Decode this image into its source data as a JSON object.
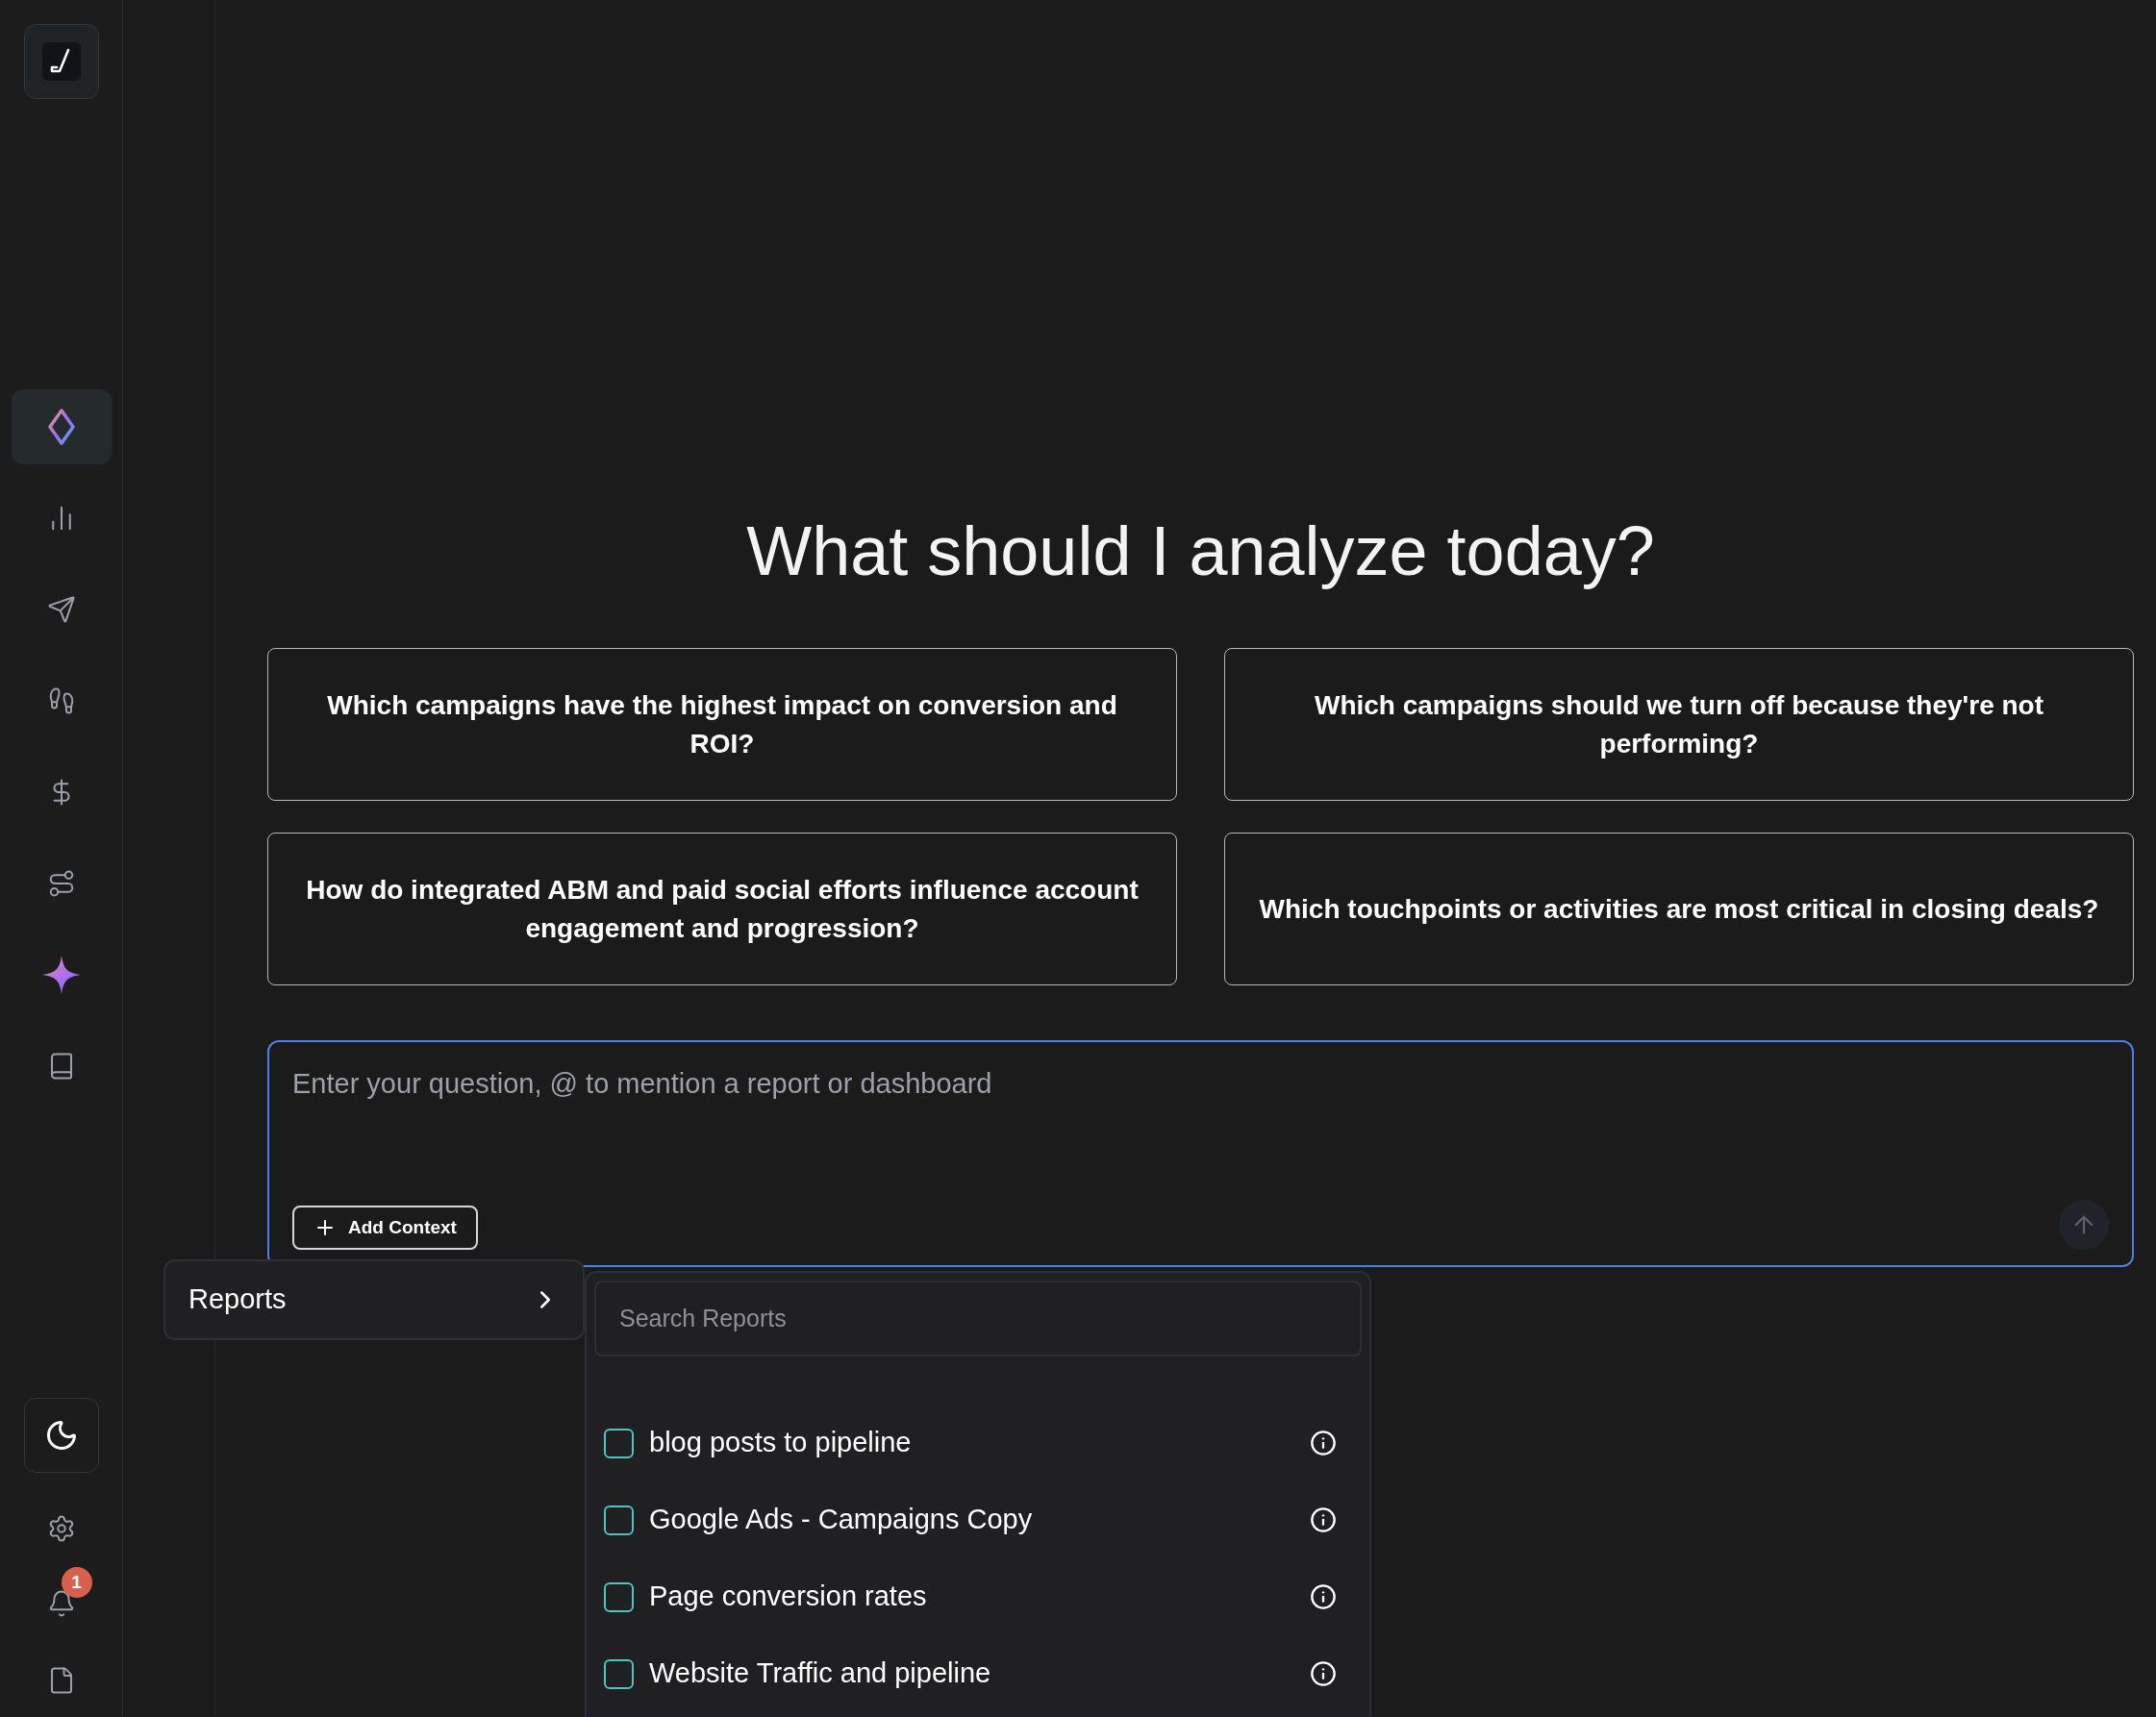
{
  "sidebar": {
    "nav_items": [
      {
        "selected": true
      },
      {
        "selected": false
      },
      {
        "selected": false
      },
      {
        "selected": false
      },
      {
        "selected": false
      },
      {
        "selected": false
      },
      {
        "selected": false
      },
      {
        "selected": false
      }
    ],
    "notification_count": "1"
  },
  "heading": "What should I analyze today?",
  "suggestions": [
    "Which campaigns have the highest impact on conversion and ROI?",
    "Which campaigns should we turn off because they're not performing?",
    "How do integrated ABM and paid social efforts influence account engagement and progression?",
    "Which touchpoints or activities are most critical in closing deals?"
  ],
  "question_input": {
    "placeholder": "Enter your question, @ to mention a report or dashboard",
    "add_context_button": "Add Context"
  },
  "context_menu": {
    "items": [
      {
        "label": "Reports"
      }
    ]
  },
  "reports_panel": {
    "search": {
      "placeholder": "Search Reports"
    },
    "reports": [
      {
        "name": "blog posts to pipeline",
        "checked": false
      },
      {
        "name": "Google Ads - Campaigns Copy",
        "checked": false
      },
      {
        "name": "Page conversion rates",
        "checked": false
      },
      {
        "name": "Website Traffic and pipeline",
        "checked": false
      }
    ]
  }
}
